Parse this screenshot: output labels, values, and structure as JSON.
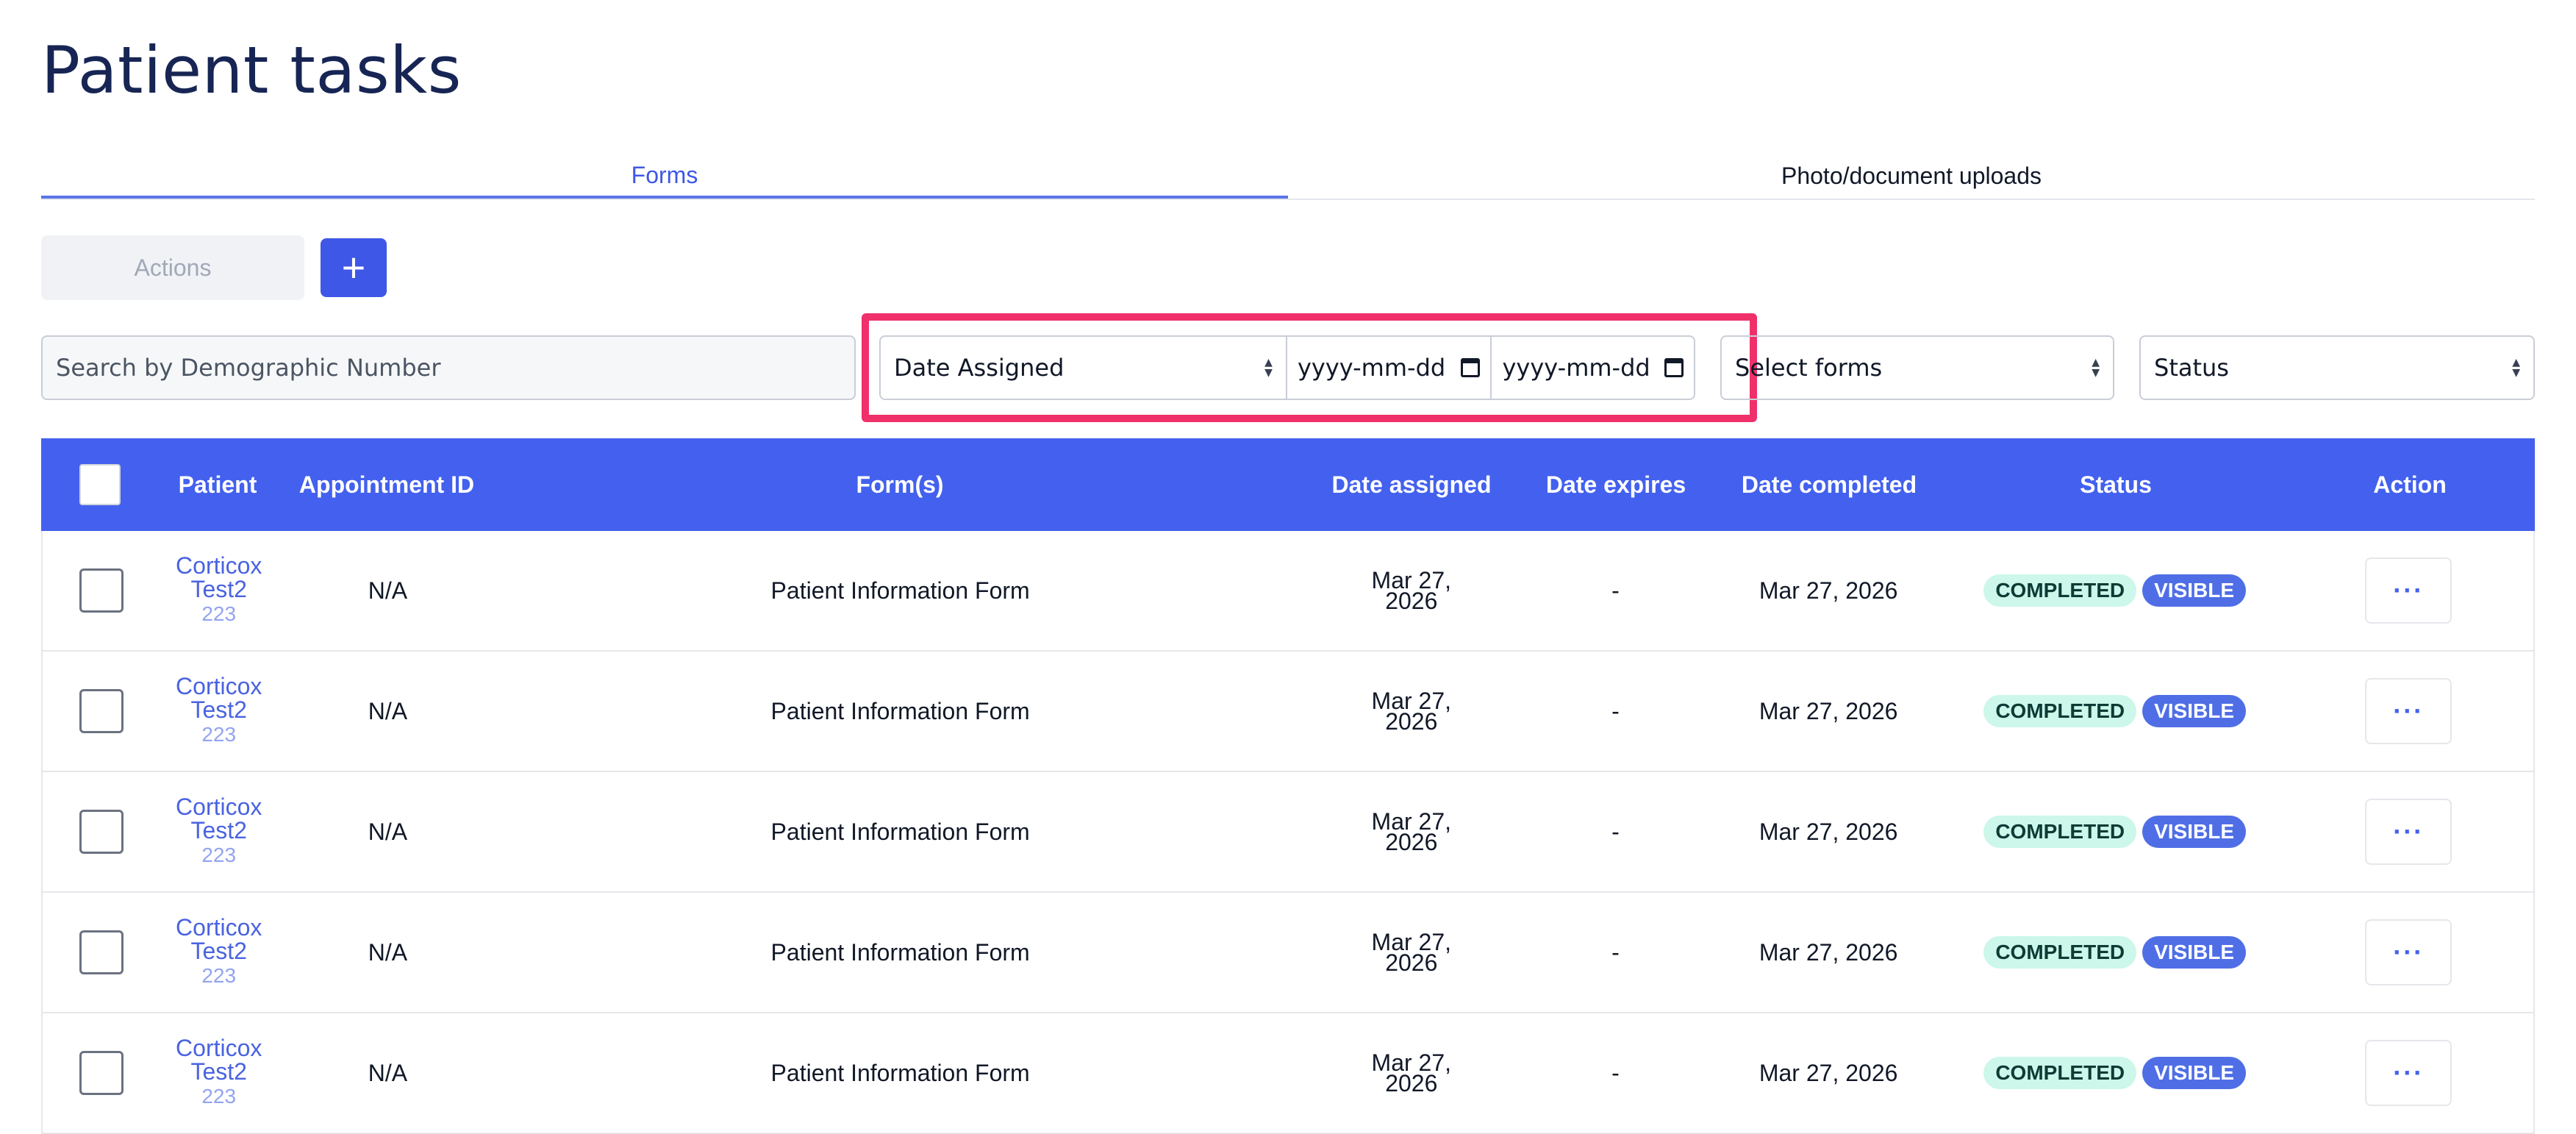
{
  "page": {
    "title": "Patient tasks"
  },
  "tabs": [
    {
      "label": "Forms",
      "active": true
    },
    {
      "label": "Photo/document uploads",
      "active": false
    }
  ],
  "toolbar": {
    "actions_label": "Actions",
    "add_label": "+"
  },
  "filters": {
    "search_placeholder": "Search by Demographic Number",
    "date_type": "Date Assigned",
    "date_from_placeholder": "yyyy-mm-dd",
    "date_to_placeholder": "yyyy-mm-dd",
    "forms_select": "Select forms",
    "status_select": "Status"
  },
  "table": {
    "headers": {
      "patient": "Patient",
      "appointment_id": "Appointment ID",
      "forms": "Form(s)",
      "date_assigned": "Date assigned",
      "date_expires": "Date expires",
      "date_completed": "Date completed",
      "status": "Status",
      "action": "Action"
    },
    "rows": [
      {
        "patient_first": "Corticox",
        "patient_last": "Test2",
        "patient_id": "223",
        "appointment_id": "N/A",
        "form": "Patient Information Form",
        "assigned_line1": "Mar 27,",
        "assigned_line2": "2026",
        "expires": "-",
        "completed": "Mar 27, 2026",
        "status": "COMPLETED",
        "visibility": "VISIBLE",
        "action": "···"
      },
      {
        "patient_first": "Corticox",
        "patient_last": "Test2",
        "patient_id": "223",
        "appointment_id": "N/A",
        "form": "Patient Information Form",
        "assigned_line1": "Mar 27,",
        "assigned_line2": "2026",
        "expires": "-",
        "completed": "Mar 27, 2026",
        "status": "COMPLETED",
        "visibility": "VISIBLE",
        "action": "···"
      },
      {
        "patient_first": "Corticox",
        "patient_last": "Test2",
        "patient_id": "223",
        "appointment_id": "N/A",
        "form": "Patient Information Form",
        "assigned_line1": "Mar 27,",
        "assigned_line2": "2026",
        "expires": "-",
        "completed": "Mar 27, 2026",
        "status": "COMPLETED",
        "visibility": "VISIBLE",
        "action": "···"
      },
      {
        "patient_first": "Corticox",
        "patient_last": "Test2",
        "patient_id": "223",
        "appointment_id": "N/A",
        "form": "Patient Information Form",
        "assigned_line1": "Mar 27,",
        "assigned_line2": "2026",
        "expires": "-",
        "completed": "Mar 27, 2026",
        "status": "COMPLETED",
        "visibility": "VISIBLE",
        "action": "···"
      },
      {
        "patient_first": "Corticox",
        "patient_last": "Test2",
        "patient_id": "223",
        "appointment_id": "N/A",
        "form": "Patient Information Form",
        "assigned_line1": "Mar 27,",
        "assigned_line2": "2026",
        "expires": "-",
        "completed": "Mar 27, 2026",
        "status": "COMPLETED",
        "visibility": "VISIBLE",
        "action": "···"
      }
    ]
  },
  "colors": {
    "accent": "#4361ee",
    "highlight": "#f0306a",
    "completed_bg": "#ccf7ea",
    "visible_bg": "#4f6ee6"
  }
}
